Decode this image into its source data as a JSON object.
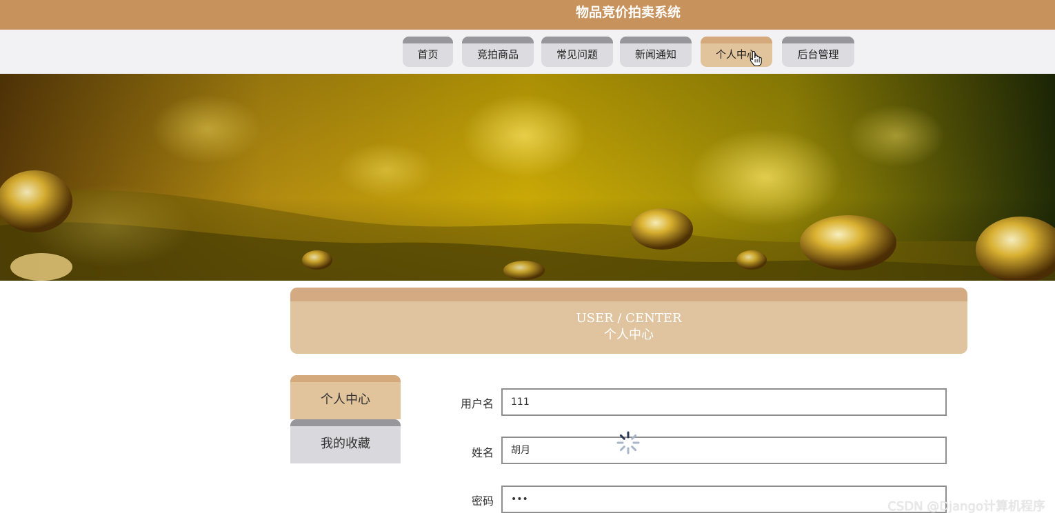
{
  "app": {
    "title": "物品竞价拍卖系统"
  },
  "nav": {
    "items": [
      {
        "label": "首页"
      },
      {
        "label": "竞拍商品"
      },
      {
        "label": "常见问题"
      },
      {
        "label": "新闻通知"
      },
      {
        "label": "个人中心",
        "active": true
      },
      {
        "label": "后台管理"
      }
    ]
  },
  "section": {
    "title_en": "USER / CENTER",
    "title_cn": "个人中心"
  },
  "sidebar": {
    "items": [
      {
        "label": "个人中心",
        "active": true
      },
      {
        "label": "我的收藏"
      }
    ]
  },
  "form": {
    "fields": [
      {
        "label": "用户名",
        "value": "111"
      },
      {
        "label": "姓名",
        "value": "胡月"
      },
      {
        "label": "密码",
        "value": "•••"
      }
    ]
  },
  "watermark": "CSDN @Django计算机程序",
  "icons": {
    "cursor": "hand-pointer-icon",
    "loading": "loading-spinner-icon"
  },
  "colors": {
    "header": "#c8925c",
    "accent_active": "#e1c49c",
    "accent_active_top": "#d4a97b",
    "nav_inactive": "#dcdbdf",
    "nav_inactive_top": "#97969b"
  }
}
